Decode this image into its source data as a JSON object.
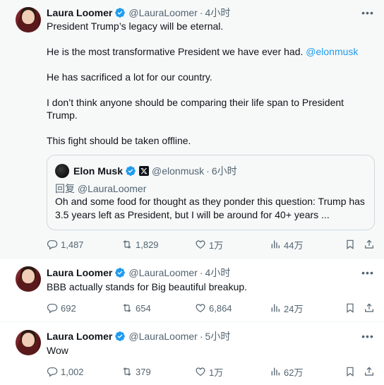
{
  "tweets": [
    {
      "author": {
        "name": "Laura Loomer",
        "handle": "@LauraLoomer"
      },
      "time": "4小时",
      "body": {
        "p1": "President Trump’s legacy will be eternal.",
        "p2_text": "He is the most transformative President we have ever had. ",
        "p2_mention": "@elonmusk",
        "p3": "He has sacrificed a lot for our country.",
        "p4": "I don’t think anyone should be comparing their life span to President Trump.",
        "p5": "This fight should be taken offline."
      },
      "quote": {
        "name": "Elon Musk",
        "handle": "@elonmusk",
        "time": "6小时",
        "reply_to": "回复 @LauraLoomer",
        "text": "Oh and some food for thought as they ponder this question: Trump has 3.5 years left as President, but I will be around for 40+ years ..."
      },
      "stats": {
        "replies": "1,487",
        "reposts": "1,829",
        "likes": "1万",
        "views": "44万"
      }
    },
    {
      "author": {
        "name": "Laura Loomer",
        "handle": "@LauraLoomer"
      },
      "time": "4小时",
      "body": {
        "p1": "BBB actually stands for Big beautiful breakup."
      },
      "stats": {
        "replies": "692",
        "reposts": "654",
        "likes": "6,864",
        "views": "24万"
      }
    },
    {
      "author": {
        "name": "Laura Loomer",
        "handle": "@LauraLoomer"
      },
      "time": "5小时",
      "body": {
        "p1": "Wow"
      },
      "stats": {
        "replies": "1,002",
        "reposts": "379",
        "likes": "1万",
        "views": "62万"
      }
    }
  ],
  "separator": "·",
  "more_label": "•••",
  "colors": {
    "accent": "#1d9bf0",
    "muted": "#536471",
    "text": "#0f1419",
    "highlight_bg": "#f7f9f9"
  },
  "icons": [
    "verified-badge-icon",
    "more-icon",
    "reply-icon",
    "repost-icon",
    "like-icon",
    "views-icon",
    "bookmark-icon",
    "share-icon",
    "x-logo-icon"
  ]
}
